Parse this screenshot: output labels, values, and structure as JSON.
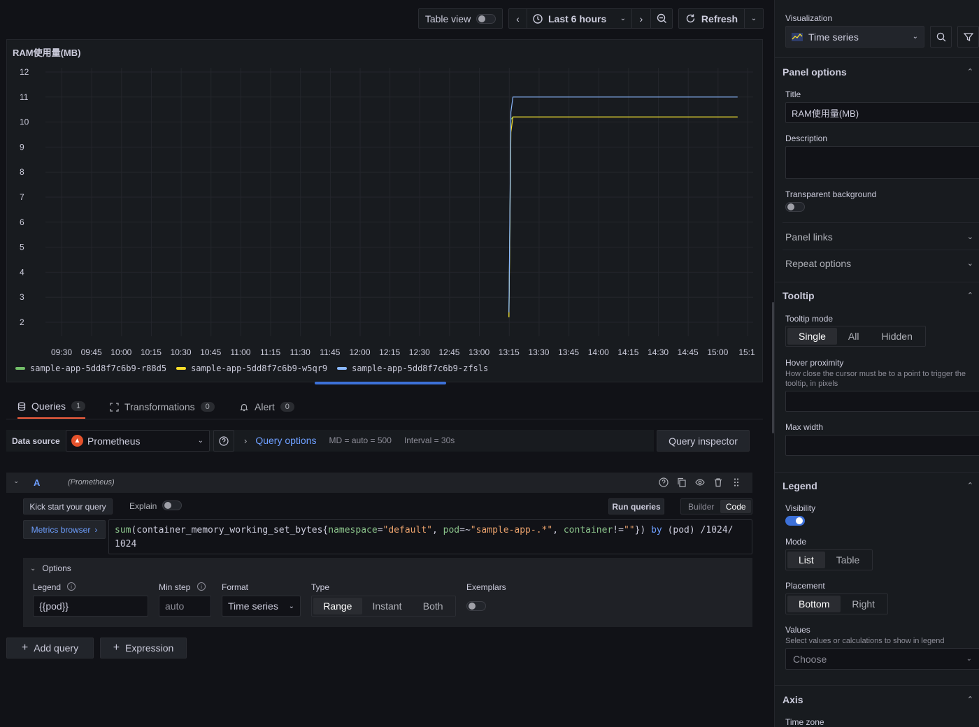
{
  "toolbar": {
    "table_view_label": "Table view",
    "time_range_label": "Last 6 hours",
    "refresh_label": "Refresh"
  },
  "panel": {
    "title": "RAM使用量(MB)"
  },
  "chart_data": {
    "type": "line",
    "title": "RAM使用量(MB)",
    "y_ticks": [
      "12",
      "11",
      "10",
      "9",
      "8",
      "7",
      "6",
      "5",
      "4",
      "3",
      "2"
    ],
    "ylim": [
      2,
      12
    ],
    "x_ticks": [
      "09:30",
      "09:45",
      "10:00",
      "10:15",
      "10:30",
      "10:45",
      "11:00",
      "11:15",
      "11:30",
      "11:45",
      "12:00",
      "12:15",
      "12:30",
      "12:45",
      "13:00",
      "13:15",
      "13:30",
      "13:45",
      "14:00",
      "14:15",
      "14:30",
      "14:45",
      "15:00",
      "15:1"
    ],
    "grid": true,
    "legend_placement": "bottom",
    "series": [
      {
        "name": "sample-app-5dd8f7c6b9-r88d5",
        "color": "#73bf69",
        "x": [
          "13:15",
          "13:16",
          "13:17",
          "13:30",
          "13:45",
          "14:00",
          "14:15",
          "14:30",
          "14:45",
          "15:00",
          "15:10"
        ],
        "values": [
          2.2,
          10.1,
          10.2,
          10.2,
          10.2,
          10.2,
          10.2,
          10.2,
          10.2,
          10.2,
          10.2
        ]
      },
      {
        "name": "sample-app-5dd8f7c6b9-w5qr9",
        "color": "#fade2a",
        "x": [
          "13:15",
          "13:16",
          "13:17",
          "13:30",
          "13:45",
          "14:00",
          "14:15",
          "14:30",
          "14:45",
          "15:00",
          "15:10"
        ],
        "values": [
          2.2,
          9.6,
          10.2,
          10.2,
          10.2,
          10.2,
          10.2,
          10.2,
          10.2,
          10.2,
          10.2
        ]
      },
      {
        "name": "sample-app-5dd8f7c6b9-zfsls",
        "color": "#8ab8ff",
        "x": [
          "13:15",
          "13:16",
          "13:17",
          "13:30",
          "13:45",
          "14:00",
          "14:15",
          "14:30",
          "14:45",
          "15:00",
          "15:10"
        ],
        "values": [
          2.4,
          10.4,
          11.0,
          11.0,
          11.0,
          11.0,
          11.0,
          11.0,
          11.0,
          11.0,
          11.0
        ]
      }
    ]
  },
  "tabs": [
    {
      "label": "Queries",
      "count": "1"
    },
    {
      "label": "Transformations",
      "count": "0"
    },
    {
      "label": "Alert",
      "count": "0"
    }
  ],
  "datasource": {
    "label": "Data source",
    "value": "Prometheus",
    "query_options": "Query options",
    "md": "MD = auto = 500",
    "interval": "Interval = 30s",
    "inspector": "Query inspector"
  },
  "query": {
    "ref": "A",
    "source": "(Prometheus)",
    "kick_start": "Kick start your query",
    "explain": "Explain",
    "run_queries": "Run queries",
    "builder": "Builder",
    "code": "Code",
    "metrics_browser": "Metrics browser",
    "expr": {
      "fn": "sum",
      "p1": "(container_memory_working_set_bytes{",
      "k1": "namespace",
      "e1": "=",
      "v1": "\"default\"",
      "c1": ", ",
      "k2": "pod",
      "e2": "=~",
      "v2": "\"sample-app-.*\"",
      "c2": ", ",
      "k3": "container",
      "e3": "!=",
      "v3": "\"\"",
      "p2": "}) ",
      "by": "by",
      "p3": " (pod) /1024/",
      "line2": "1024"
    },
    "options_label": "Options",
    "legend_label": "Legend",
    "legend_value": "{{pod}}",
    "min_step_label": "Min step",
    "min_step_placeholder": "auto",
    "format_label": "Format",
    "format_value": "Time series",
    "type_label": "Type",
    "type_options": [
      "Range",
      "Instant",
      "Both"
    ],
    "exemplars_label": "Exemplars"
  },
  "actions": {
    "add_query": "Add query",
    "expression": "Expression"
  },
  "sidebar": {
    "visualization_label": "Visualization",
    "visualization_value": "Time series",
    "panel_options": "Panel options",
    "title_label": "Title",
    "title_value": "RAM使用量(MB)",
    "description_label": "Description",
    "transparent_label": "Transparent background",
    "panel_links": "Panel links",
    "repeat_options": "Repeat options",
    "tooltip": "Tooltip",
    "tooltip_mode_label": "Tooltip mode",
    "tooltip_modes": [
      "Single",
      "All",
      "Hidden"
    ],
    "hover_label": "Hover proximity",
    "hover_desc": "How close the cursor must be to a point to trigger the tooltip, in pixels",
    "max_width_label": "Max width",
    "legend": "Legend",
    "visibility_label": "Visibility",
    "mode_label": "Mode",
    "modes": [
      "List",
      "Table"
    ],
    "placement_label": "Placement",
    "placements": [
      "Bottom",
      "Right"
    ],
    "values_label": "Values",
    "values_desc": "Select values or calculations to show in legend",
    "values_placeholder": "Choose",
    "axis": "Axis",
    "time_zone_label": "Time zone"
  }
}
